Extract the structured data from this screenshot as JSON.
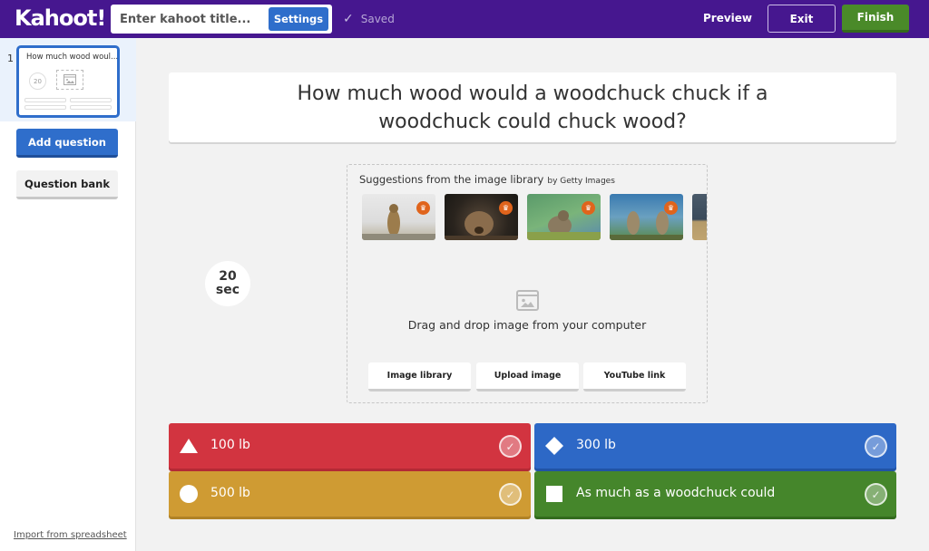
{
  "topbar": {
    "logo": "Kahoot!",
    "title_placeholder": "Enter kahoot title...",
    "title_value": "",
    "settings_label": "Settings",
    "saved_status": "Saved",
    "preview_label": "Preview",
    "exit_label": "Exit",
    "finish_label": "Finish"
  },
  "sidebar": {
    "slides": [
      {
        "number": "1",
        "title": "How much wood woul...",
        "timer": "20"
      }
    ],
    "add_question_label": "Add question",
    "question_bank_label": "Question bank",
    "import_link": "Import from spreadsheet"
  },
  "question": {
    "text": "How much wood would a woodchuck chuck if a woodchuck could chuck wood?",
    "timer_value": "20",
    "timer_unit": "sec"
  },
  "media": {
    "suggestions_title": "Suggestions from the image library",
    "suggestions_by": "by Getty Images",
    "images": [
      {
        "name": "marmot-standing-snow",
        "premium": true
      },
      {
        "name": "marmot-closeup-dark",
        "premium": true
      },
      {
        "name": "marmot-grass-green",
        "premium": true
      },
      {
        "name": "two-marmots-standing",
        "premium": true
      },
      {
        "name": "marmot-partial",
        "premium": false
      }
    ],
    "drag_text": "Drag and drop image from your computer",
    "buttons": [
      "Image library",
      "Upload image",
      "YouTube link"
    ]
  },
  "answers": [
    {
      "text": "100 lb",
      "shape": "triangle",
      "color": "#d23440",
      "correct": false
    },
    {
      "text": "300 lb",
      "shape": "diamond",
      "color": "#2d68c6",
      "correct": false
    },
    {
      "text": "500 lb",
      "shape": "circle",
      "color": "#cf9b33",
      "correct": false
    },
    {
      "text": "As much as a woodchuck could",
      "shape": "square",
      "color": "#45862b",
      "correct": false
    }
  ],
  "colors": {
    "brand_purple": "#46178f",
    "primary_blue": "#2f6ecb",
    "finish_green": "#4a8a29",
    "premium_badge": "#e0641c"
  }
}
